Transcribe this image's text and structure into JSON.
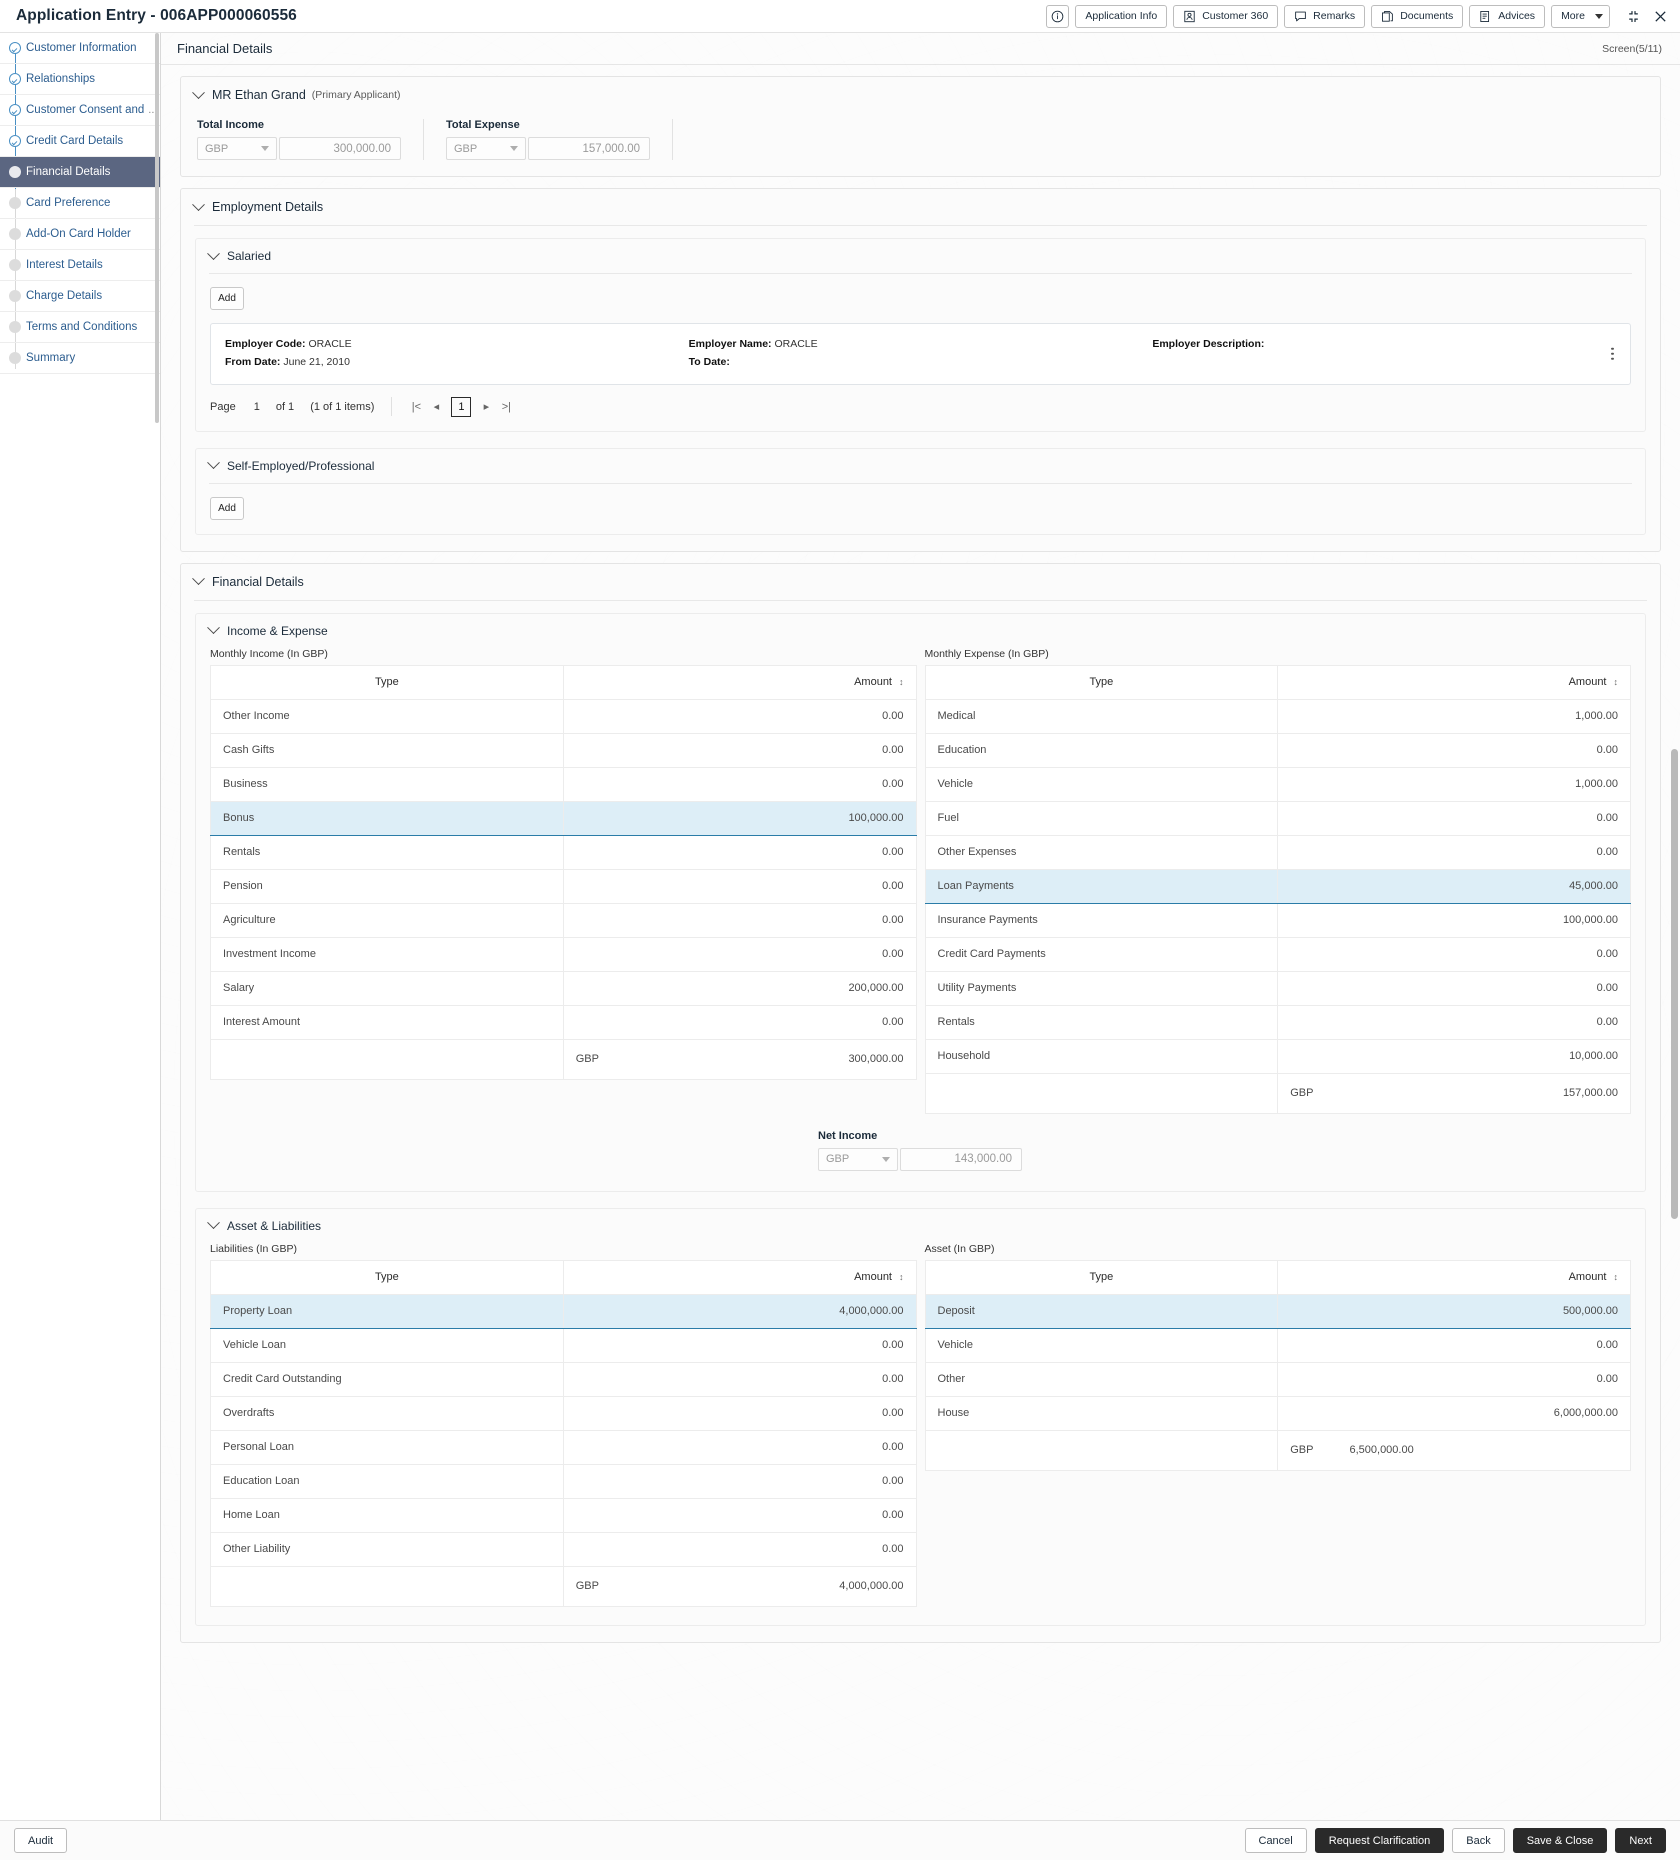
{
  "titlebar": {
    "app_title": "Application Entry - 006APP000060556",
    "buttons": [
      {
        "label": "",
        "icon": "info-icon",
        "icon_only": true
      },
      {
        "label": "Application Info",
        "icon": ""
      },
      {
        "label": "Customer 360",
        "icon": "user-card-icon"
      },
      {
        "label": "Remarks",
        "icon": "speech-bubble-icon"
      },
      {
        "label": "Documents",
        "icon": "documents-icon"
      },
      {
        "label": "Advices",
        "icon": "advices-icon"
      },
      {
        "label": "More",
        "icon": "chevron-down-icon"
      }
    ],
    "window_controls": [
      "minimize-restore-icon",
      "close-icon"
    ]
  },
  "sidebar": {
    "items": [
      {
        "label": "Customer Information",
        "state": "done"
      },
      {
        "label": "Relationships",
        "state": "done"
      },
      {
        "label": "Customer Consent and",
        "ellipsis": "...",
        "state": "done"
      },
      {
        "label": "Credit Card Details",
        "state": "done"
      },
      {
        "label": "Financial Details",
        "state": "current"
      },
      {
        "label": "Card Preference",
        "state": "pending"
      },
      {
        "label": "Add-On Card Holder",
        "state": "pending"
      },
      {
        "label": "Interest Details",
        "state": "pending"
      },
      {
        "label": "Charge Details",
        "state": "pending"
      },
      {
        "label": "Terms and Conditions",
        "state": "pending"
      },
      {
        "label": "Summary",
        "state": "pending"
      }
    ]
  },
  "content": {
    "title": "Financial Details",
    "screen_count": "Screen(5/11)"
  },
  "applicant": {
    "name": "MR Ethan Grand",
    "role": "(Primary Applicant)",
    "total_income": {
      "label": "Total Income",
      "currency": "GBP",
      "amount": "300,000.00"
    },
    "total_expense": {
      "label": "Total Expense",
      "currency": "GBP",
      "amount": "157,000.00"
    }
  },
  "employment": {
    "section_label": "Employment Details",
    "salaried": {
      "label": "Salaried",
      "add_label": "Add",
      "record": {
        "employer_code_label": "Employer Code:",
        "employer_code": "ORACLE",
        "from_date_label": "From Date:",
        "from_date": "June 21, 2010",
        "employer_name_label": "Employer Name:",
        "employer_name": "ORACLE",
        "to_date_label": "To Date:",
        "to_date": "",
        "employer_description_label": "Employer Description:",
        "employer_description": ""
      },
      "pager": {
        "page_label": "Page",
        "page_number": "1",
        "of_label": "of 1",
        "items_label": "(1 of 1 items)",
        "first": "|<",
        "prev": "◂",
        "current": "1",
        "next": "▸",
        "last": ">|"
      }
    },
    "self_employed": {
      "label": "Self-Employed/Professional",
      "add_label": "Add"
    }
  },
  "financial_details": {
    "section_label": "Financial Details",
    "income_expense": {
      "label": "Income & Expense",
      "income": {
        "caption": "Monthly Income (In GBP)",
        "columns": [
          "Type",
          "Amount"
        ],
        "rows": [
          {
            "type": "Other Income",
            "amount": "0.00",
            "highlighted": false
          },
          {
            "type": "Cash Gifts",
            "amount": "0.00",
            "highlighted": false
          },
          {
            "type": "Business",
            "amount": "0.00",
            "highlighted": false
          },
          {
            "type": "Bonus",
            "amount": "100,000.00",
            "highlighted": true
          },
          {
            "type": "Rentals",
            "amount": "0.00",
            "highlighted": false
          },
          {
            "type": "Pension",
            "amount": "0.00",
            "highlighted": false
          },
          {
            "type": "Agriculture",
            "amount": "0.00",
            "highlighted": false
          },
          {
            "type": "Investment Income",
            "amount": "0.00",
            "highlighted": false
          },
          {
            "type": "Salary",
            "amount": "200,000.00",
            "highlighted": false
          },
          {
            "type": "Interest Amount",
            "amount": "0.00",
            "highlighted": false
          }
        ],
        "total": {
          "currency": "GBP",
          "amount": "300,000.00"
        }
      },
      "expense": {
        "caption": "Monthly Expense (In GBP)",
        "columns": [
          "Type",
          "Amount"
        ],
        "rows": [
          {
            "type": "Medical",
            "amount": "1,000.00",
            "highlighted": false
          },
          {
            "type": "Education",
            "amount": "0.00",
            "highlighted": false
          },
          {
            "type": "Vehicle",
            "amount": "1,000.00",
            "highlighted": false
          },
          {
            "type": "Fuel",
            "amount": "0.00",
            "highlighted": false
          },
          {
            "type": "Other Expenses",
            "amount": "0.00",
            "highlighted": false
          },
          {
            "type": "Loan Payments",
            "amount": "45,000.00",
            "highlighted": true
          },
          {
            "type": "Insurance Payments",
            "amount": "100,000.00",
            "highlighted": false
          },
          {
            "type": "Credit Card Payments",
            "amount": "0.00",
            "highlighted": false
          },
          {
            "type": "Utility Payments",
            "amount": "0.00",
            "highlighted": false
          },
          {
            "type": "Rentals",
            "amount": "0.00",
            "highlighted": false
          },
          {
            "type": "Household",
            "amount": "10,000.00",
            "highlighted": false
          }
        ],
        "total": {
          "currency": "GBP",
          "amount": "157,000.00"
        }
      },
      "net_income": {
        "label": "Net Income",
        "currency": "GBP",
        "amount": "143,000.00"
      }
    },
    "asset_liabilities": {
      "label": "Asset & Liabilities",
      "liabilities": {
        "caption": "Liabilities (In GBP)",
        "columns": [
          "Type",
          "Amount"
        ],
        "rows": [
          {
            "type": "Property Loan",
            "amount": "4,000,000.00",
            "highlighted": true
          },
          {
            "type": "Vehicle Loan",
            "amount": "0.00",
            "highlighted": false
          },
          {
            "type": "Credit Card Outstanding",
            "amount": "0.00",
            "highlighted": false
          },
          {
            "type": "Overdrafts",
            "amount": "0.00",
            "highlighted": false
          },
          {
            "type": "Personal Loan",
            "amount": "0.00",
            "highlighted": false
          },
          {
            "type": "Education Loan",
            "amount": "0.00",
            "highlighted": false
          },
          {
            "type": "Home Loan",
            "amount": "0.00",
            "highlighted": false
          },
          {
            "type": "Other Liability",
            "amount": "0.00",
            "highlighted": false
          }
        ],
        "total": {
          "currency": "GBP",
          "amount": "4,000,000.00"
        }
      },
      "asset": {
        "caption": "Asset (In GBP)",
        "columns": [
          "Type",
          "Amount"
        ],
        "rows": [
          {
            "type": "Deposit",
            "amount": "500,000.00",
            "highlighted": true
          },
          {
            "type": "Vehicle",
            "amount": "0.00",
            "highlighted": false
          },
          {
            "type": "Other",
            "amount": "0.00",
            "highlighted": false
          },
          {
            "type": "House",
            "amount": "6,000,000.00",
            "highlighted": false
          }
        ],
        "total": {
          "currency": "GBP",
          "amount": "6,500,000.00"
        }
      }
    }
  },
  "footer": {
    "audit_label": "Audit",
    "buttons": [
      {
        "label": "Cancel",
        "style": "light"
      },
      {
        "label": "Request Clarification",
        "style": "dark"
      },
      {
        "label": "Back",
        "style": "light"
      },
      {
        "label": "Save & Close",
        "style": "dark"
      },
      {
        "label": "Next",
        "style": "dark"
      }
    ]
  },
  "colors": {
    "accent_nav": "#5b6681",
    "link": "#2c5d8f",
    "row_highlight": "#ddeef7",
    "row_highlight_border": "#2a7ca8",
    "dark_button": "#2a2a2a"
  }
}
